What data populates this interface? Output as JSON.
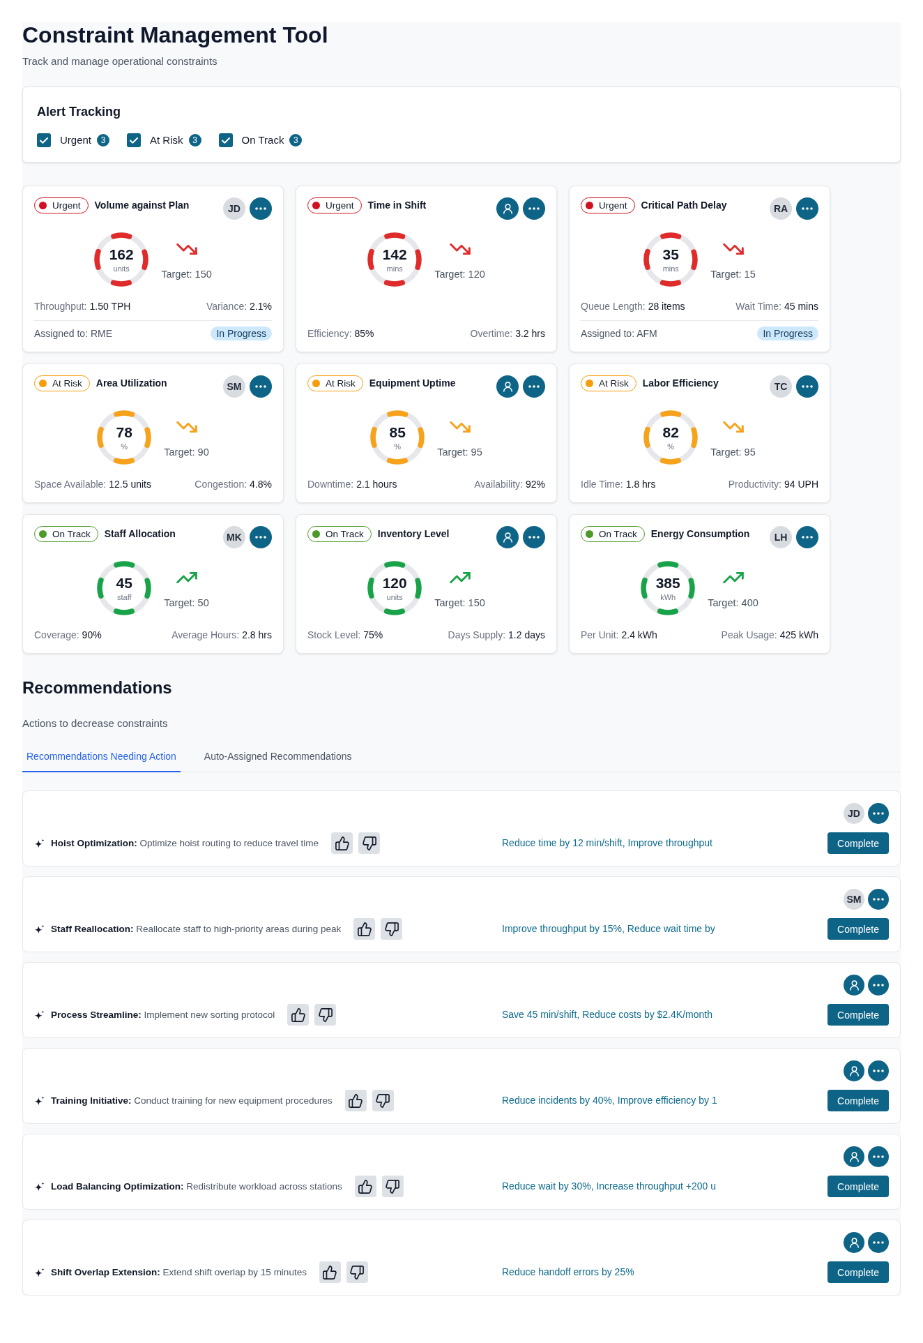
{
  "header": {
    "title": "Constraint Management Tool",
    "subtitle": "Track and manage operational constraints"
  },
  "alert_tracking": {
    "title": "Alert Tracking",
    "filters": [
      {
        "label": "Urgent",
        "count": "3",
        "checked": true
      },
      {
        "label": "At Risk",
        "count": "3",
        "checked": true
      },
      {
        "label": "On Track",
        "count": "3",
        "checked": true
      }
    ]
  },
  "metric_cards": [
    {
      "status": {
        "kind": "urgent",
        "label": "Urgent",
        "color": "#d0111f"
      },
      "title": "Volume against Plan",
      "assignee": {
        "kind": "initials",
        "initials": "JD"
      },
      "gauge": {
        "value": "162",
        "unit": "units"
      },
      "trend": {
        "kind": "down"
      },
      "target": "Target: 150",
      "metrics": [
        {
          "label": "Throughput:",
          "value": "1.50 TPH"
        },
        {
          "label": "Variance:",
          "value": "2.1%"
        }
      ],
      "assignment": {
        "text": "Assigned to: RME",
        "state": "In Progress"
      }
    },
    {
      "status": {
        "kind": "urgent",
        "label": "Urgent",
        "color": "#d0111f"
      },
      "title": "Time in Shift",
      "assignee": {
        "kind": "unassigned"
      },
      "gauge": {
        "value": "142",
        "unit": "mins"
      },
      "trend": {
        "kind": "down"
      },
      "target": "Target: 120",
      "metrics": [
        {
          "label": "Efficiency:",
          "value": "85%"
        },
        {
          "label": "Overtime:",
          "value": "3.2 hrs"
        }
      ]
    },
    {
      "status": {
        "kind": "urgent",
        "label": "Urgent",
        "color": "#d0111f"
      },
      "title": "Critical Path Delay",
      "assignee": {
        "kind": "initials",
        "initials": "RA"
      },
      "gauge": {
        "value": "35",
        "unit": "mins"
      },
      "trend": {
        "kind": "down"
      },
      "target": "Target: 15",
      "metrics": [
        {
          "label": "Queue Length:",
          "value": "28 items"
        },
        {
          "label": "Wait Time:",
          "value": "45 mins"
        }
      ],
      "assignment": {
        "text": "Assigned to: AFM",
        "state": "In Progress"
      }
    },
    {
      "status": {
        "kind": "at_risk",
        "label": "At Risk",
        "color": "#f59e0b"
      },
      "title": "Area Utilization",
      "assignee": {
        "kind": "initials",
        "initials": "SM"
      },
      "gauge": {
        "value": "78",
        "unit": "%"
      },
      "trend": {
        "kind": "down"
      },
      "target": "Target: 90",
      "metrics": [
        {
          "label": "Space Available:",
          "value": "12.5 units"
        },
        {
          "label": "Congestion:",
          "value": "4.8%"
        }
      ]
    },
    {
      "status": {
        "kind": "at_risk",
        "label": "At Risk",
        "color": "#f59e0b"
      },
      "title": "Equipment Uptime",
      "assignee": {
        "kind": "unassigned"
      },
      "gauge": {
        "value": "85",
        "unit": "%"
      },
      "trend": {
        "kind": "down"
      },
      "target": "Target: 95",
      "metrics": [
        {
          "label": "Downtime:",
          "value": "2.1 hours"
        },
        {
          "label": "Availability:",
          "value": "92%"
        }
      ]
    },
    {
      "status": {
        "kind": "at_risk",
        "label": "At Risk",
        "color": "#f59e0b"
      },
      "title": "Labor Efficiency",
      "assignee": {
        "kind": "initials",
        "initials": "TC"
      },
      "gauge": {
        "value": "82",
        "unit": "%"
      },
      "trend": {
        "kind": "down"
      },
      "target": "Target: 95",
      "metrics": [
        {
          "label": "Idle Time:",
          "value": "1.8 hrs"
        },
        {
          "label": "Productivity:",
          "value": "94 UPH"
        }
      ]
    },
    {
      "status": {
        "kind": "on_track",
        "label": "On Track",
        "color": "#4c9a2a"
      },
      "title": "Staff Allocation",
      "assignee": {
        "kind": "initials",
        "initials": "MK"
      },
      "gauge": {
        "value": "45",
        "unit": "staff"
      },
      "trend": {
        "kind": "up"
      },
      "target": "Target: 50",
      "metrics": [
        {
          "label": "Coverage:",
          "value": "90%"
        },
        {
          "label": "Average Hours:",
          "value": "2.8 hrs"
        }
      ]
    },
    {
      "status": {
        "kind": "on_track",
        "label": "On Track",
        "color": "#4c9a2a"
      },
      "title": "Inventory Level",
      "assignee": {
        "kind": "unassigned"
      },
      "gauge": {
        "value": "120",
        "unit": "units"
      },
      "trend": {
        "kind": "up"
      },
      "target": "Target: 150",
      "metrics": [
        {
          "label": "Stock Level:",
          "value": "75%"
        },
        {
          "label": "Days Supply:",
          "value": "1.2 days"
        }
      ]
    },
    {
      "status": {
        "kind": "on_track",
        "label": "On Track",
        "color": "#4c9a2a"
      },
      "title": "Energy Consumption",
      "assignee": {
        "kind": "initials",
        "initials": "LH"
      },
      "gauge": {
        "value": "385",
        "unit": "kWh"
      },
      "trend": {
        "kind": "up"
      },
      "target": "Target: 400",
      "metrics": [
        {
          "label": "Per Unit:",
          "value": "2.4 kWh"
        },
        {
          "label": "Peak Usage:",
          "value": "425 kWh"
        }
      ]
    }
  ],
  "recommendations": {
    "title": "Recommendations",
    "subtitle": "Actions to decrease constraints",
    "tabs": [
      {
        "label": "Recommendations Needing Action",
        "selected": true
      },
      {
        "label": "Auto-Assigned Recommendations",
        "selected": false
      }
    ],
    "items": [
      {
        "text": "**Hoist Optimization:** Optimize hoist routing to reduce travel time",
        "impact": "Reduce time by 12 min/shift, Improve throughput",
        "assignee": {
          "kind": "initials",
          "initials": "JD"
        },
        "action": "Complete"
      },
      {
        "text": "**Staff Reallocation:** Reallocate staff to high-priority areas during peak",
        "impact": "Improve throughput by 15%, Reduce wait time by",
        "assignee": {
          "kind": "initials",
          "initials": "SM"
        },
        "action": "Complete"
      },
      {
        "text": "**Process Streamline:** Implement new sorting protocol",
        "impact": "Save 45 min/shift, Reduce costs by $2.4K/month",
        "assignee": {
          "kind": "unassigned"
        },
        "action": "Complete"
      },
      {
        "text": "**Training Initiative:** Conduct training for new equipment procedures",
        "impact": "Reduce incidents by 40%, Improve efficiency by 1",
        "assignee": {
          "kind": "unassigned"
        },
        "action": "Complete"
      },
      {
        "text": "**Load Balancing Optimization:** Redistribute workload across stations",
        "impact": "Reduce wait by 30%, Increase throughput +200 u",
        "assignee": {
          "kind": "unassigned"
        },
        "action": "Complete"
      },
      {
        "text": "**Shift Overlap Extension:** Extend shift overlap by 15 minutes",
        "impact": "Reduce handoff errors by 25%",
        "assignee": {
          "kind": "unassigned"
        },
        "action": "Complete"
      }
    ]
  }
}
